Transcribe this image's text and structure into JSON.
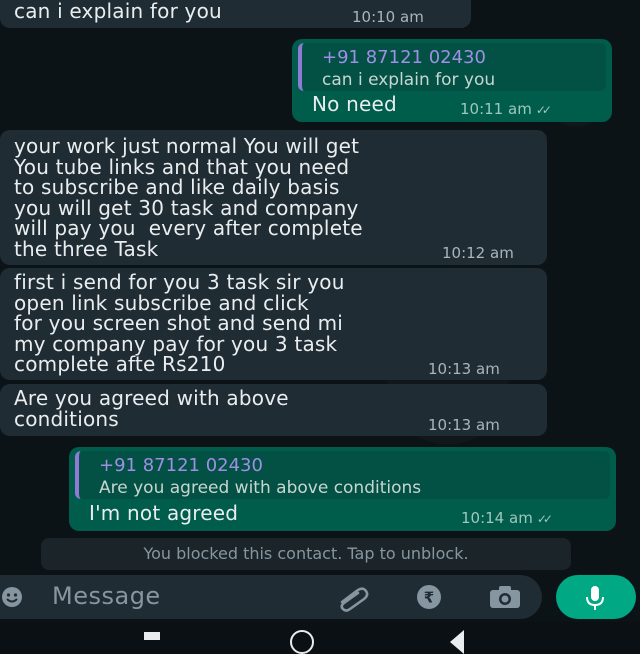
{
  "messages": [
    {
      "text": "can i explain for you",
      "time": "10:10 am"
    },
    {
      "quote_name": "+91 87121 02430",
      "quote_text": "can i explain for you",
      "text": "No need",
      "time": "10:11 am"
    },
    {
      "text": "your work just normal You will get\nYou tube links and that you need\nto subscribe and like daily basis\nyou will get 30 task and company\nwill pay you  every after complete\nthe three Task",
      "time": "10:12 am"
    },
    {
      "text": "first i send for you 3 task sir you\nopen link subscribe and click\nfor you screen shot and send mi\nmy company pay for you 3 task\ncomplete afte Rs210",
      "time": "10:13 am"
    },
    {
      "text": "Are you agreed with above\nconditions",
      "time": "10:13 am"
    },
    {
      "quote_name": "+91 87121 02430",
      "quote_text": "Are you agreed with above conditions",
      "text": "I'm not agreed",
      "time": "10:14 am"
    }
  ],
  "system_notice": "You blocked this contact. Tap to unblock.",
  "composer": {
    "placeholder": "Message"
  },
  "icons": [
    "emoji-icon",
    "attach-icon",
    "rupee-icon",
    "camera-icon",
    "mic-icon"
  ],
  "colors": {
    "incoming_bubble": "#202c33",
    "outgoing_bubble": "#005c4b",
    "accent": "#00a884",
    "quote_bar": "#8f7bd6"
  }
}
